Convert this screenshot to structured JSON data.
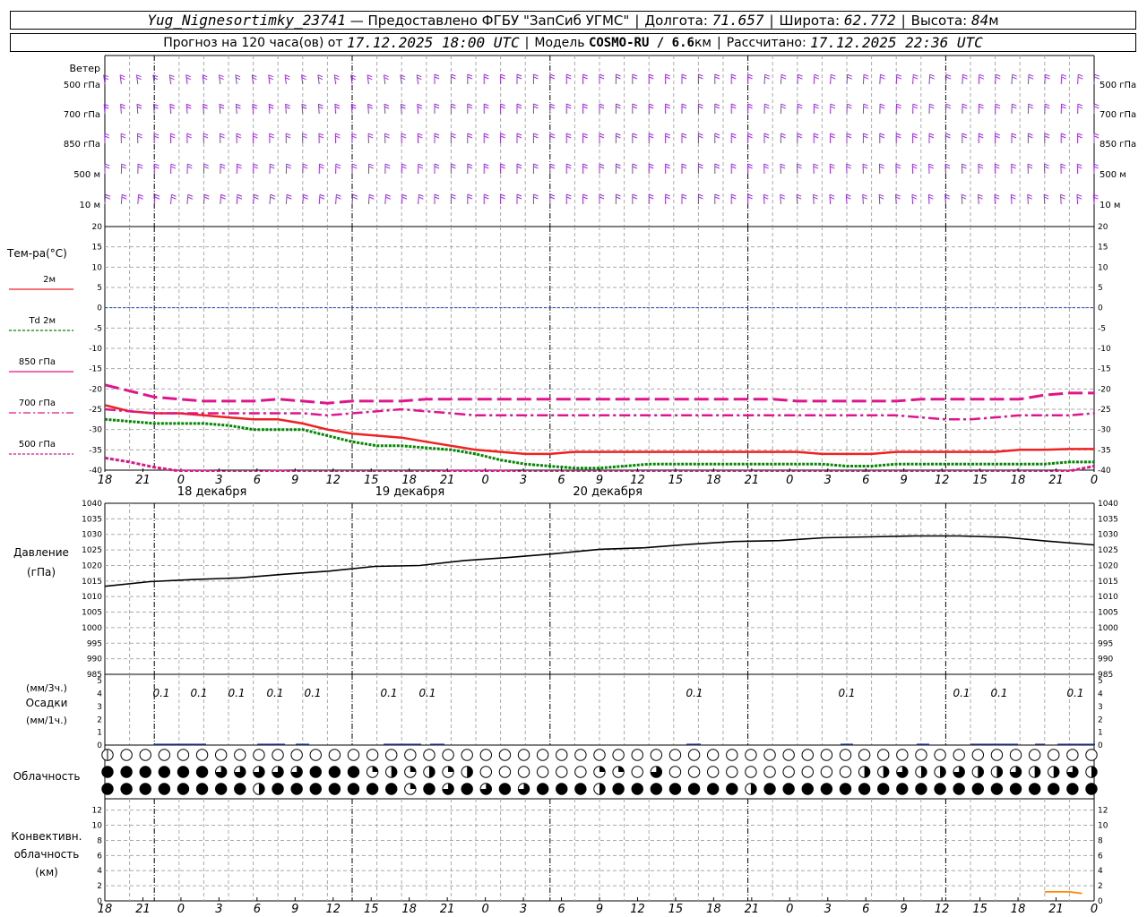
{
  "header": {
    "station": "Yug_Nignesortimky_23741",
    "provider": "— Предоставлено ФГБУ \"ЗапСиб УГМС\"",
    "lon_label": "Долгота:",
    "lon": "71.657",
    "lat_label": "Широта:",
    "lat": "62.772",
    "alt_label": "Высота:",
    "alt": "84",
    "alt_unit": "м",
    "forecast_label": "Прогноз на 120 часа(ов) от",
    "forecast_time": "17.12.2025 18:00 UTC",
    "model_label": "Модель",
    "model": "COSMO-RU / 6.6",
    "model_unit": "км",
    "calc_label": "Рассчитано:",
    "calc_time": "17.12.2025 22:36 UTC"
  },
  "time_axis": {
    "hour_labels": [
      "18",
      "21",
      "0",
      "3",
      "6",
      "9",
      "12",
      "15",
      "18",
      "21",
      "0",
      "3",
      "6",
      "9",
      "12",
      "15",
      "18",
      "21",
      "0",
      "3",
      "6",
      "9",
      "12",
      "15",
      "18",
      "21",
      "0"
    ],
    "day_labels": [
      "18 декабря",
      "19 декабря",
      "20 декабря"
    ]
  },
  "wind_panel": {
    "title": "Ветер",
    "levels": [
      {
        "num": "500",
        "unit": "гПа"
      },
      {
        "num": "700",
        "unit": "гПа"
      },
      {
        "num": "850",
        "unit": "гПа"
      },
      {
        "num": "500",
        "unit": "м"
      },
      {
        "num": "10",
        "unit": "м"
      }
    ],
    "color": "#9b30e0"
  },
  "temp_panel": {
    "title": "Тем-ра(°C)",
    "legend": [
      {
        "label": "2м",
        "color": "#ee2222"
      },
      {
        "label": "Td 2м",
        "color": "#008800"
      },
      {
        "label": "850 гПа",
        "color": "#e0148c"
      },
      {
        "label": "700 гПа",
        "color": "#e0148c"
      },
      {
        "label": "500 гПа",
        "color": "#e0148c"
      }
    ],
    "ticks": [
      "20",
      "15",
      "10",
      "5",
      "0",
      "-5",
      "-10",
      "-15",
      "-20",
      "-25",
      "-30",
      "-35",
      "-40"
    ]
  },
  "pressure_panel": {
    "title": "Давление",
    "unit": "(гПа)",
    "ticks": [
      "1040",
      "1035",
      "1030",
      "1025",
      "1020",
      "1015",
      "1010",
      "1005",
      "1000",
      "995",
      "990",
      "985"
    ]
  },
  "precip_panel": {
    "unit3": "(мм/3ч.)",
    "title": "Осадки",
    "unit1": "(мм/1ч.)",
    "ticks": [
      "5",
      "4",
      "3",
      "2",
      "1",
      "0"
    ],
    "labels": [
      "0.1",
      "0.1",
      "0.1",
      "0.1",
      "0.1",
      "0.1",
      "0.1",
      "0.1",
      "0.1",
      "0.1",
      "0.1",
      "0.1"
    ]
  },
  "cloud_panel": {
    "title": "Облачность"
  },
  "conv_panel": {
    "title1": "Конвективн.",
    "title2": "облачность",
    "unit": "(км)",
    "ticks": [
      "12",
      "10",
      "8",
      "6",
      "4",
      "2",
      "0"
    ]
  },
  "chart_data": [
    {
      "type": "line",
      "title": "Тем-ра(°C)",
      "x": [
        0,
        3,
        6,
        9,
        12,
        15,
        18,
        21,
        24,
        27,
        30,
        33,
        36,
        39,
        42,
        45,
        48,
        51,
        54,
        57,
        60,
        63,
        66,
        69,
        72,
        75,
        78,
        81,
        84,
        87,
        90,
        93,
        96,
        99,
        102,
        105,
        108,
        111,
        114,
        117,
        120
      ],
      "ylim": [
        -40,
        20
      ],
      "series": [
        {
          "name": "2м",
          "values": [
            -24,
            -25.5,
            -26,
            -26,
            -26.5,
            -27,
            -27.5,
            -27.5,
            -28.5,
            -30,
            -31,
            -31.5,
            -32,
            -33,
            -34,
            -35,
            -35.5,
            -36,
            -36,
            -35.5,
            -35.5,
            -35.5,
            -35.5,
            -35.5,
            -35.5,
            -35.5,
            -35.5,
            -35.5,
            -35.5,
            -36,
            -36,
            -36,
            -35.5,
            -35.5,
            -35.5,
            -35.5,
            -35.5,
            -35,
            -35,
            -34.8,
            -34.8
          ]
        },
        {
          "name": "Td 2м",
          "values": [
            -27.5,
            -28,
            -28.5,
            -28.5,
            -28.5,
            -29,
            -30,
            -30,
            -30,
            -31.5,
            -33,
            -34,
            -34,
            -34.5,
            -35,
            -36,
            -37.5,
            -38.5,
            -39,
            -39.5,
            -39.5,
            -39,
            -38.5,
            -38.5,
            -38.5,
            -38.5,
            -38.5,
            -38.5,
            -38.5,
            -38.5,
            -39,
            -39,
            -38.5,
            -38.5,
            -38.5,
            -38.5,
            -38.5,
            -38.5,
            -38.5,
            -38,
            -38
          ]
        },
        {
          "name": "850 гПа",
          "values": [
            -19,
            -20.5,
            -22,
            -22.5,
            -23,
            -23,
            -23,
            -22.5,
            -23,
            -23.5,
            -23,
            -23,
            -23,
            -22.5,
            -22.5,
            -22.5,
            -22.5,
            -22.5,
            -22.5,
            -22.5,
            -22.5,
            -22.5,
            -22.5,
            -22.5,
            -22.5,
            -22.5,
            -22.5,
            -22.5,
            -23,
            -23,
            -23,
            -23,
            -23,
            -22.5,
            -22.5,
            -22.5,
            -22.5,
            -22.5,
            -21.5,
            -21,
            -21
          ]
        },
        {
          "name": "700 гПа",
          "values": [
            -25,
            -25.5,
            -26,
            -26,
            -26,
            -26,
            -26,
            -26,
            -26,
            -26.5,
            -26,
            -25.5,
            -25,
            -25.5,
            -26,
            -26.5,
            -26.5,
            -26.5,
            -26.5,
            -26.5,
            -26.5,
            -26.5,
            -26.5,
            -26.5,
            -26.5,
            -26.5,
            -26.5,
            -26.5,
            -26.5,
            -26.5,
            -26.5,
            -26.5,
            -26.5,
            -27,
            -27.5,
            -27.5,
            -27,
            -26.5,
            -26.5,
            -26.5,
            -26
          ]
        },
        {
          "name": "500 гПа",
          "values": [
            -37,
            -38,
            -39.3,
            -40.2,
            -40.2,
            -40.5,
            -40.5,
            -40.2,
            -40.5,
            -40.5,
            -40.5,
            -40.5,
            -40.5,
            -40.5,
            -40.2,
            -40.2,
            -40.2,
            -40.5,
            -40.5,
            -40.5,
            -40.5,
            -40.5,
            -40.5,
            -40.5,
            -40.5,
            -40.5,
            -40.5,
            -40.5,
            -40.5,
            -40.5,
            -40.5,
            -40.5,
            -40.5,
            -40.5,
            -40.5,
            -40.5,
            -40.5,
            -40.5,
            -40.5,
            -40.2,
            -39
          ]
        }
      ]
    },
    {
      "type": "line",
      "title": "Давление",
      "ylabel": "(гПа)",
      "x": [
        0,
        6,
        12,
        18,
        24,
        30,
        36,
        42,
        48,
        54,
        60,
        66,
        72,
        78,
        84,
        90,
        96,
        102,
        108,
        114,
        120
      ],
      "ylim": [
        985,
        1040
      ],
      "series": [
        {
          "name": "Давление",
          "values": [
            1013.3,
            1014.8,
            1015.5,
            1016.0,
            1017.2,
            1018.2,
            1019.7,
            1020.0,
            1021.6,
            1022.6,
            1023.8,
            1025.2,
            1025.7,
            1026.8,
            1027.7,
            1028.0,
            1028.9,
            1029.2,
            1029.5,
            1029.5,
            1029.1,
            1027.8,
            1026.6
          ]
        }
      ]
    },
    {
      "type": "bar",
      "title": "Осадки",
      "ylabel": "(мм/3ч.)",
      "ylim": [
        0,
        5
      ],
      "categories": [
        "21",
        "0",
        "3",
        "6",
        "9",
        "15",
        "18",
        "12",
        "3",
        "12",
        "15",
        "21"
      ],
      "values": [
        0.1,
        0.1,
        0.1,
        0.1,
        0.1,
        0.1,
        0.1,
        0.1,
        0.1,
        0.1,
        0.1,
        0.1
      ]
    },
    {
      "type": "line",
      "title": "Конвективн. облачность",
      "ylabel": "(км)",
      "ylim": [
        0,
        13
      ],
      "x": [
        114,
        117,
        118.5
      ],
      "series": [
        {
          "name": "Конвективн. облачность",
          "values": [
            1.2,
            1.2,
            1.0
          ]
        }
      ]
    }
  ]
}
